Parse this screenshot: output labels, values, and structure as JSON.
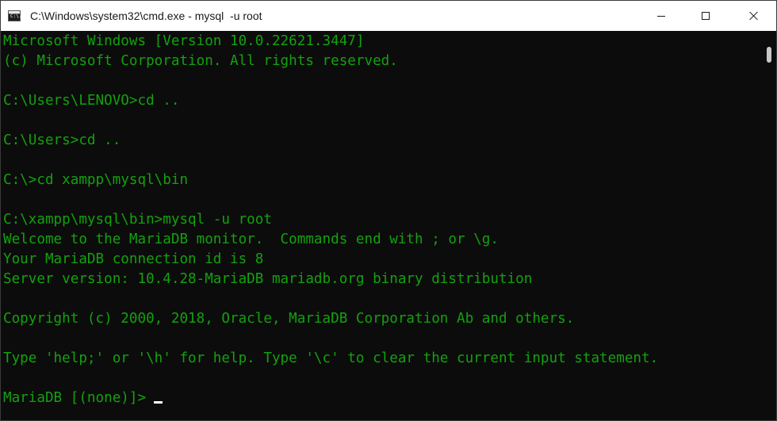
{
  "window": {
    "title": "C:\\Windows\\system32\\cmd.exe - mysql  -u root",
    "icon": "cmd-icon",
    "icon_text": "C:\\."
  },
  "controls": {
    "minimize": "minimize-icon",
    "maximize": "maximize-icon",
    "close": "close-icon"
  },
  "console": {
    "text_color": "#13a10e",
    "background": "#0c0c0c",
    "lines": [
      "Microsoft Windows [Version 10.0.22621.3447]",
      "(c) Microsoft Corporation. All rights reserved.",
      "",
      "C:\\Users\\LENOVO>cd ..",
      "",
      "C:\\Users>cd ..",
      "",
      "C:\\>cd xampp\\mysql\\bin",
      "",
      "C:\\xampp\\mysql\\bin>mysql -u root",
      "Welcome to the MariaDB monitor.  Commands end with ; or \\g.",
      "Your MariaDB connection id is 8",
      "Server version: 10.4.28-MariaDB mariadb.org binary distribution",
      "",
      "Copyright (c) 2000, 2018, Oracle, MariaDB Corporation Ab and others.",
      "",
      "Type 'help;' or '\\h' for help. Type '\\c' to clear the current input statement.",
      "",
      "MariaDB [(none)]>"
    ]
  }
}
